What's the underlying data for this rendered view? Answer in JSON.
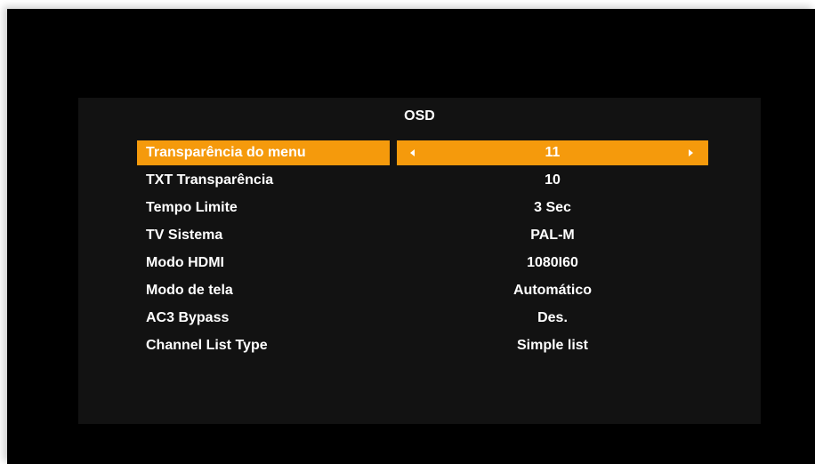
{
  "menu": {
    "title": "OSD",
    "items": [
      {
        "label": "Transparência do menu",
        "value": "11"
      },
      {
        "label": "TXT Transparência",
        "value": "10"
      },
      {
        "label": "Tempo Limite",
        "value": "3 Sec"
      },
      {
        "label": "TV Sistema",
        "value": "PAL-M"
      },
      {
        "label": "Modo HDMI",
        "value": "1080I60"
      },
      {
        "label": "Modo de tela",
        "value": "Automático"
      },
      {
        "label": "AC3 Bypass",
        "value": "Des."
      },
      {
        "label": "Channel List Type",
        "value": "Simple list"
      }
    ],
    "selected_index": 0
  },
  "colors": {
    "highlight": "#f59a0c",
    "screen_bg": "#000000",
    "panel_bg": "#121212",
    "text": "#ffffff"
  }
}
